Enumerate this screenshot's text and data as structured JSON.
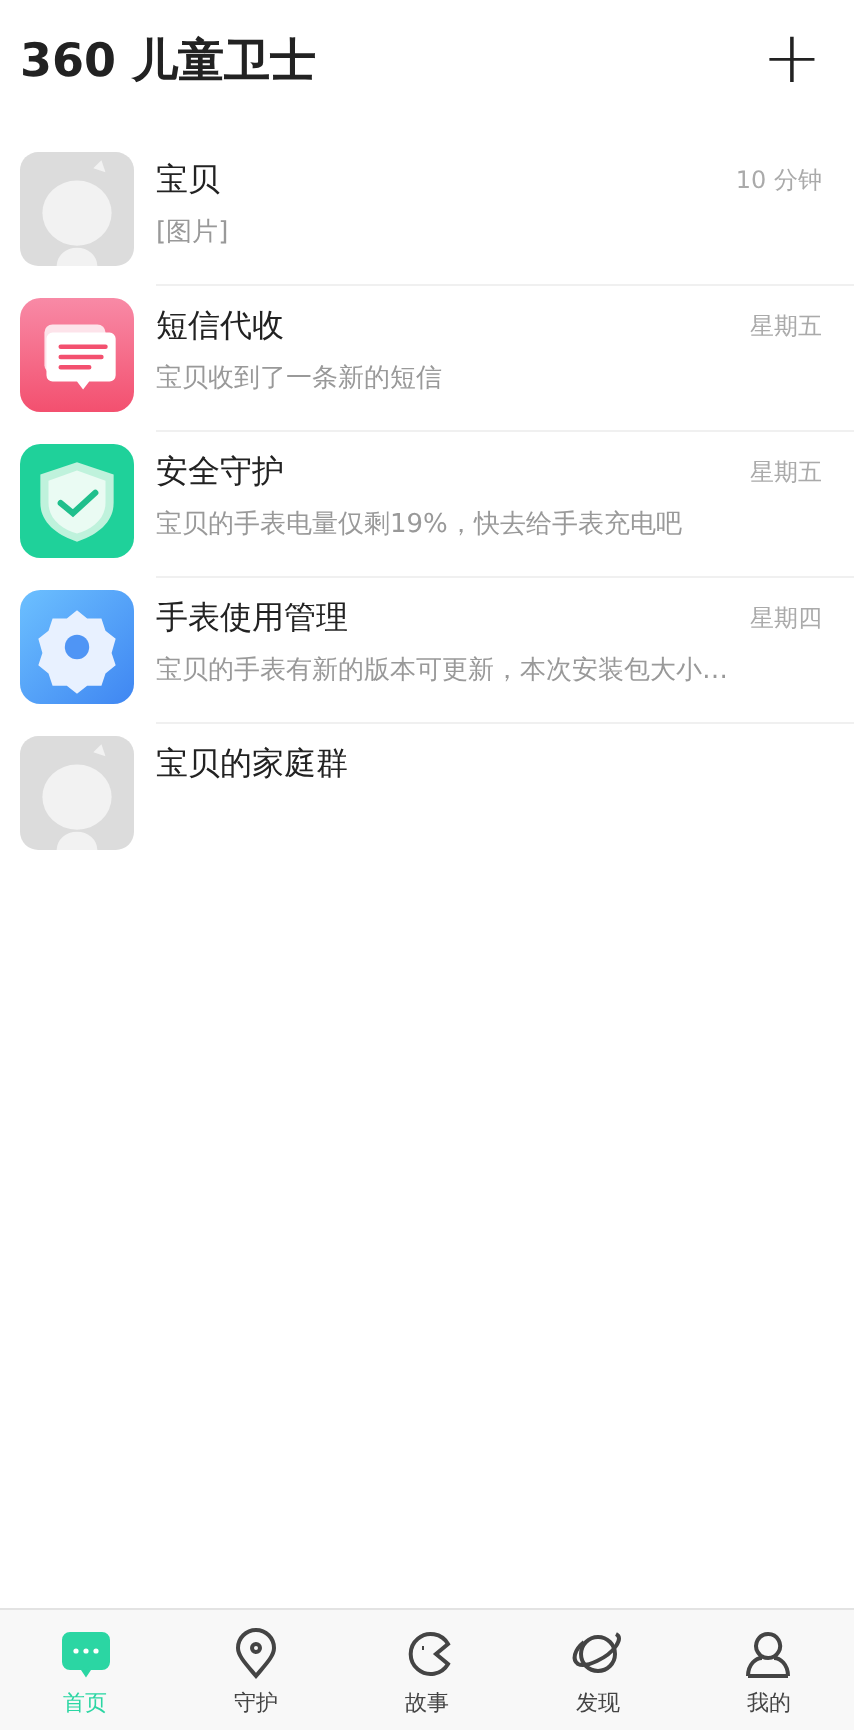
{
  "header": {
    "title": "360 儿童卫士",
    "add_icon": "+"
  },
  "conversations": [
    {
      "kind": "baby",
      "name": "宝贝",
      "time": "10 分钟",
      "preview": "[图片]"
    },
    {
      "kind": "sms",
      "name": "短信代收",
      "time": "星期五",
      "preview": "宝贝收到了一条新的短信"
    },
    {
      "kind": "shield",
      "name": "安全守护",
      "time": "星期五",
      "preview": "宝贝的手表电量仅剩19%，快去给手表充电吧"
    },
    {
      "kind": "gear",
      "name": "手表使用管理",
      "time": "星期四",
      "preview": "宝贝的手表有新的版本可更新，本次安装包大小…"
    },
    {
      "kind": "baby",
      "name": "宝贝的家庭群"
    }
  ],
  "tabs": [
    {
      "kind": "chat",
      "label": "首页",
      "selected": true
    },
    {
      "kind": "pin",
      "label": "守护",
      "selected": false
    },
    {
      "kind": "pacman",
      "label": "故事",
      "selected": false
    },
    {
      "kind": "planet",
      "label": "发现",
      "selected": false
    },
    {
      "kind": "person",
      "label": "我的",
      "selected": false
    }
  ]
}
